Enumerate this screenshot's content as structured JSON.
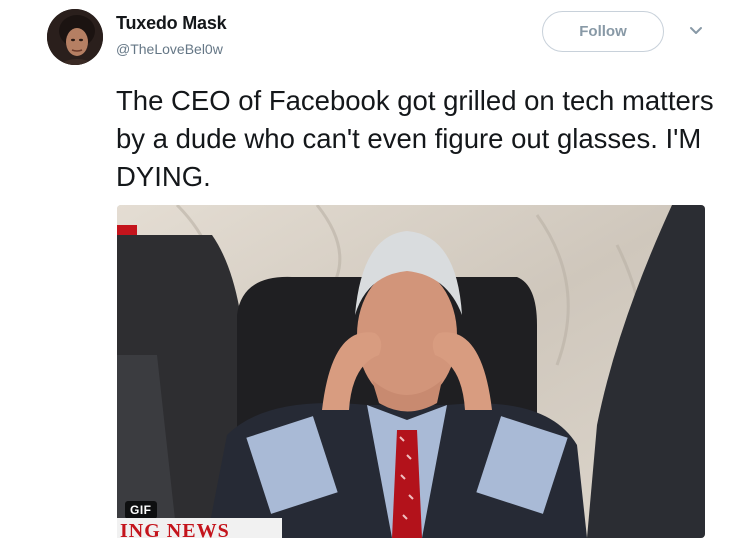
{
  "tweet": {
    "author_name": "Tuxedo Mask",
    "author_handle": "@TheLoveBel0w",
    "follow_label": "Follow",
    "text": "The CEO of Facebook got grilled on tech matters by a dude who can't even figure out glasses. I'M DYING."
  },
  "media": {
    "badge": "GIF",
    "banner_text": "ING NEWS",
    "type": "animated-gif"
  },
  "icons": {
    "avatar": "avatar-image",
    "more": "chevron-down-icon"
  },
  "colors": {
    "follow_border": "#c8d1da",
    "handle": "#657786",
    "text": "#14171a",
    "banner_red": "#c4141c"
  }
}
